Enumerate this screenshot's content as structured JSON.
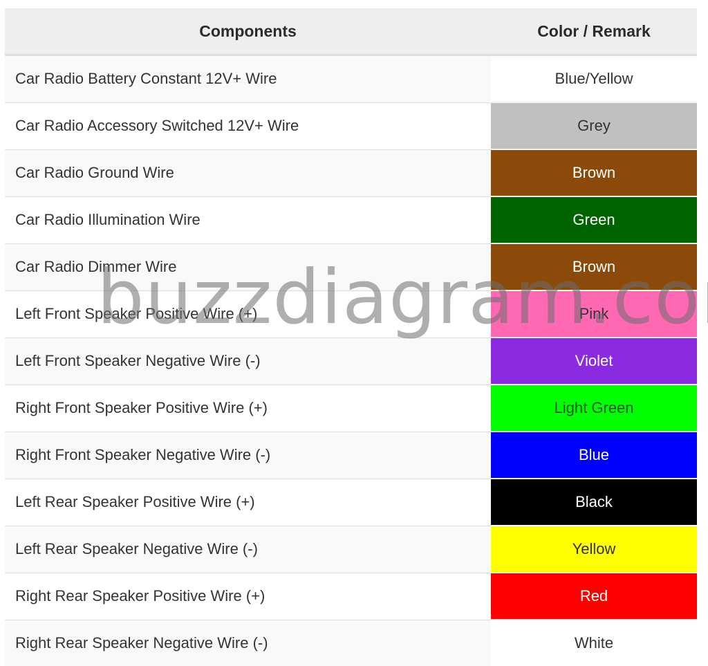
{
  "table": {
    "headers": {
      "components": "Components",
      "color_remark": "Color / Remark"
    },
    "rows": [
      {
        "component": "Car Radio Battery Constant 12V+ Wire",
        "color": "Blue/Yellow",
        "bg": "#ffffff",
        "fg": "#333333"
      },
      {
        "component": "Car Radio Accessory Switched 12V+ Wire",
        "color": "Grey",
        "bg": "#c0c0c0",
        "fg": "#333333"
      },
      {
        "component": "Car Radio Ground Wire",
        "color": "Brown",
        "bg": "#8b4a09",
        "fg": "#ffffff"
      },
      {
        "component": "Car Radio Illumination Wire",
        "color": "Green",
        "bg": "#006400",
        "fg": "#ffffff"
      },
      {
        "component": "Car Radio Dimmer Wire",
        "color": "Brown",
        "bg": "#8b4a09",
        "fg": "#ffffff"
      },
      {
        "component": "Left Front Speaker Positive Wire (+)",
        "color": "Pink",
        "bg": "#ff69b4",
        "fg": "#333333"
      },
      {
        "component": "Left Front Speaker Negative Wire (-)",
        "color": "Violet",
        "bg": "#8a2be2",
        "fg": "#ffffff"
      },
      {
        "component": "Right Front Speaker Positive Wire (+)",
        "color": "Light Green",
        "bg": "#00ff00",
        "fg": "#1a5a1a"
      },
      {
        "component": "Right Front Speaker Negative Wire (-)",
        "color": "Blue",
        "bg": "#0000ff",
        "fg": "#ffffff"
      },
      {
        "component": "Left Rear Speaker Positive Wire (+)",
        "color": "Black",
        "bg": "#000000",
        "fg": "#ffffff"
      },
      {
        "component": "Left Rear Speaker Negative Wire (-)",
        "color": "Yellow",
        "bg": "#ffff00",
        "fg": "#333333"
      },
      {
        "component": "Right Rear Speaker Positive Wire (+)",
        "color": "Red",
        "bg": "#ff0000",
        "fg": "#ffffff"
      },
      {
        "component": "Right Rear Speaker Negative Wire (-)",
        "color": "White",
        "bg": "#ffffff",
        "fg": "#333333"
      }
    ]
  },
  "watermark": "buzzdiagram.com"
}
